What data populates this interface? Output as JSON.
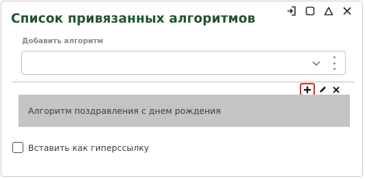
{
  "panel": {
    "title": "Список привязанных алгоритмов",
    "window_controls": [
      "exit-icon",
      "maximize-icon",
      "collapse-icon",
      "close-icon"
    ]
  },
  "add_algorithm": {
    "label": "Добавить алгоритм",
    "value": "",
    "icons": [
      "chevron-down-icon",
      "more-vertical-icon"
    ]
  },
  "list_toolbar": {
    "icons": [
      "plus-icon",
      "pencil-icon",
      "close-icon"
    ]
  },
  "algorithms": [
    {
      "name": "Алгоритм поздравления с днем рождения"
    }
  ],
  "insert_as_hyperlink": {
    "label": "Вставить как гиперссылку",
    "checked": false
  },
  "colors": {
    "title": "#1f5533",
    "selected_item_bg": "#c4c4c4",
    "highlight_border": "#e0201b"
  }
}
